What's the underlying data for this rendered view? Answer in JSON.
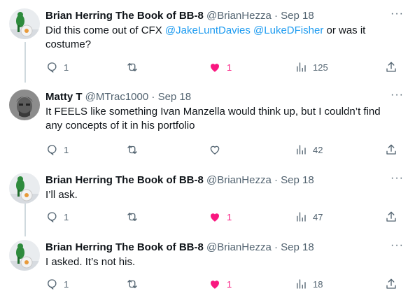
{
  "tweets": [
    {
      "name": "Brian Herring The Book of BB-8",
      "handle": "@BrianHezza",
      "separator": "·",
      "date": "Sep 18",
      "text_before": "Did this come out of CFX ",
      "mention1": "@JakeLuntDavies",
      "text_mid": " ",
      "mention2": "@LukeDFisher",
      "text_after": " or was it costume?",
      "replies": "1",
      "retweets": "",
      "likes": "1",
      "liked": true,
      "views": "125"
    },
    {
      "name": "Matty T",
      "handle": "@MTrac1000",
      "separator": "·",
      "date": "Sep 18",
      "text": "It FEELS like something Ivan Manzella would think up, but I couldn’t find any concepts of it in his portfolio",
      "replies": "1",
      "retweets": "",
      "likes": "",
      "liked": false,
      "views": "42"
    },
    {
      "name": "Brian Herring The Book of BB-8",
      "handle": "@BrianHezza",
      "separator": "·",
      "date": "Sep 18",
      "text": "I’ll ask.",
      "replies": "1",
      "retweets": "",
      "likes": "1",
      "liked": true,
      "views": "47"
    },
    {
      "name": "Brian Herring The Book of BB-8",
      "handle": "@BrianHezza",
      "separator": "·",
      "date": "Sep 18",
      "text": "I asked.  It’s not his.",
      "replies": "1",
      "retweets": "",
      "likes": "1",
      "liked": true,
      "views": "18"
    }
  ],
  "more_label": "···",
  "colors": {
    "accent": "#1d9bf0",
    "like": "#f91880",
    "muted": "#536471",
    "line": "#cfd9de"
  }
}
